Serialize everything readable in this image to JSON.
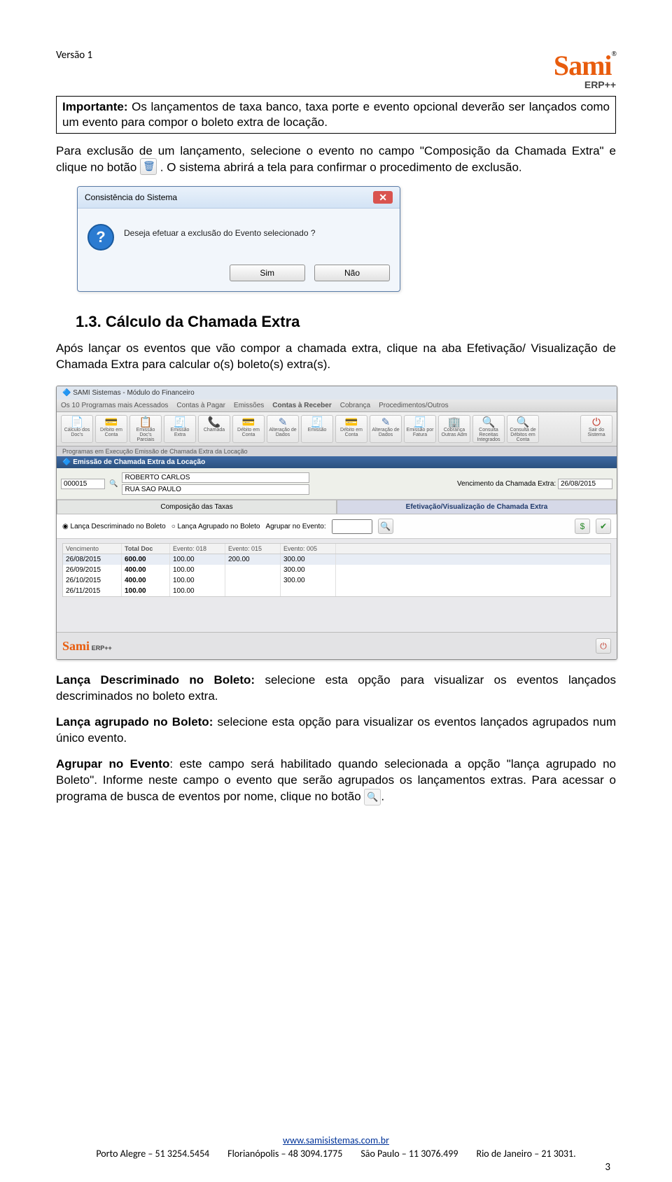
{
  "header": {
    "version": "Versão 1",
    "logo": "Sami",
    "logo_trade": "®",
    "logo_sub": "ERP++"
  },
  "important_label": "Importante:",
  "important_text": " Os lançamentos de taxa banco, taxa porte e evento opcional deverão ser lançados como um evento para compor o boleto extra de locação.",
  "p1a": "Para exclusão de um lançamento, selecione o evento no campo \"Composição da Chamada Extra\" e clique no botão ",
  "p1b": ". O sistema abrirá a tela para confirmar o procedimento de exclusão.",
  "dialog": {
    "title": "Consistência do Sistema",
    "message": "Deseja efetuar a exclusão do Evento selecionado ?",
    "yes": "Sim",
    "no": "Não"
  },
  "section": {
    "num": "1.3.",
    "title": "Cálculo da Chamada Extra"
  },
  "p2": "Após lançar os eventos que vão compor a chamada extra, clique na aba Efetivação/ Visualização de Chamada Extra para calcular o(s) boleto(s) extra(s).",
  "app": {
    "title": "SAMI Sistemas - Módulo do Financeiro",
    "menu": [
      "Os 10 Programas mais Acessados",
      "Contas à Pagar",
      "Emissões",
      "Contas à Receber",
      "Cobrança",
      "Procedimentos/Outros"
    ],
    "tools": [
      "Cálculo dos Doc's",
      "Débito em Conta",
      "Emissão Doc's Parciais",
      "Emissão Extra",
      "Chamada",
      "Débito em Conta",
      "Alteração de Dados",
      "Emissão",
      "Débito em Conta",
      "Alteração de Dados",
      "Emissão por Fatura",
      "Cobrança Outras Adm",
      "Consulta Receitas Integrados",
      "Consulta de Débitos em Conta",
      "Sair do Sistema"
    ],
    "sub": "Programas em Execução   Emissão de Chamada Extra da Locação",
    "panel": "Emissão de Chamada Extra da Locação",
    "cod": "000015",
    "nome": "ROBERTO CARLOS",
    "end": "RUA SAO PAULO",
    "venc_lbl": "Vencimento da Chamada Extra:",
    "venc_val": "26/08/2015",
    "tabs": [
      "Composição das Taxas",
      "Efetivação/Visualização de Chamada Extra"
    ],
    "opt1": "Lança Descriminado no Boleto",
    "opt2": "Lança Agrupado no Boleto",
    "opt3": "Agrupar no Evento:",
    "cols": [
      "Vencimento",
      "Total Doc",
      "Evento: 018",
      "Evento: 015",
      "Evento: 005"
    ],
    "rows": [
      [
        "26/08/2015",
        "600.00",
        "100.00",
        "200.00",
        "300.00"
      ],
      [
        "26/09/2015",
        "400.00",
        "100.00",
        "",
        "300.00"
      ],
      [
        "26/10/2015",
        "400.00",
        "100.00",
        "",
        "300.00"
      ],
      [
        "26/11/2015",
        "100.00",
        "100.00",
        "",
        ""
      ]
    ],
    "flogo": "Sami",
    "fsub": "ERP++"
  },
  "p3a": "Lança Descriminado no Boleto:",
  "p3b": " selecione esta opção para visualizar os eventos lançados descriminados no boleto extra.",
  "p4a": "Lança agrupado no Boleto:",
  "p4b": " selecione esta opção para visualizar os eventos lançados agrupados num único evento.",
  "p5a": "Agrupar no Evento",
  "p5b": ": este campo será habilitado quando selecionada a opção \"lança agrupado no Boleto\". Informe neste campo o evento que serão agrupados os lançamentos extras. Para acessar o programa de busca de eventos por nome, clique no botão ",
  "p5c": ".",
  "footer": {
    "url": "www.samisistemas.com.br",
    "c1": "Porto Alegre – 51 3254.5454",
    "c2": "Florianópolis – 48 3094.1775",
    "c3": "São Paulo – 11 3076.499",
    "c4": "Rio de Janeiro – 21 3031."
  },
  "page": "3"
}
